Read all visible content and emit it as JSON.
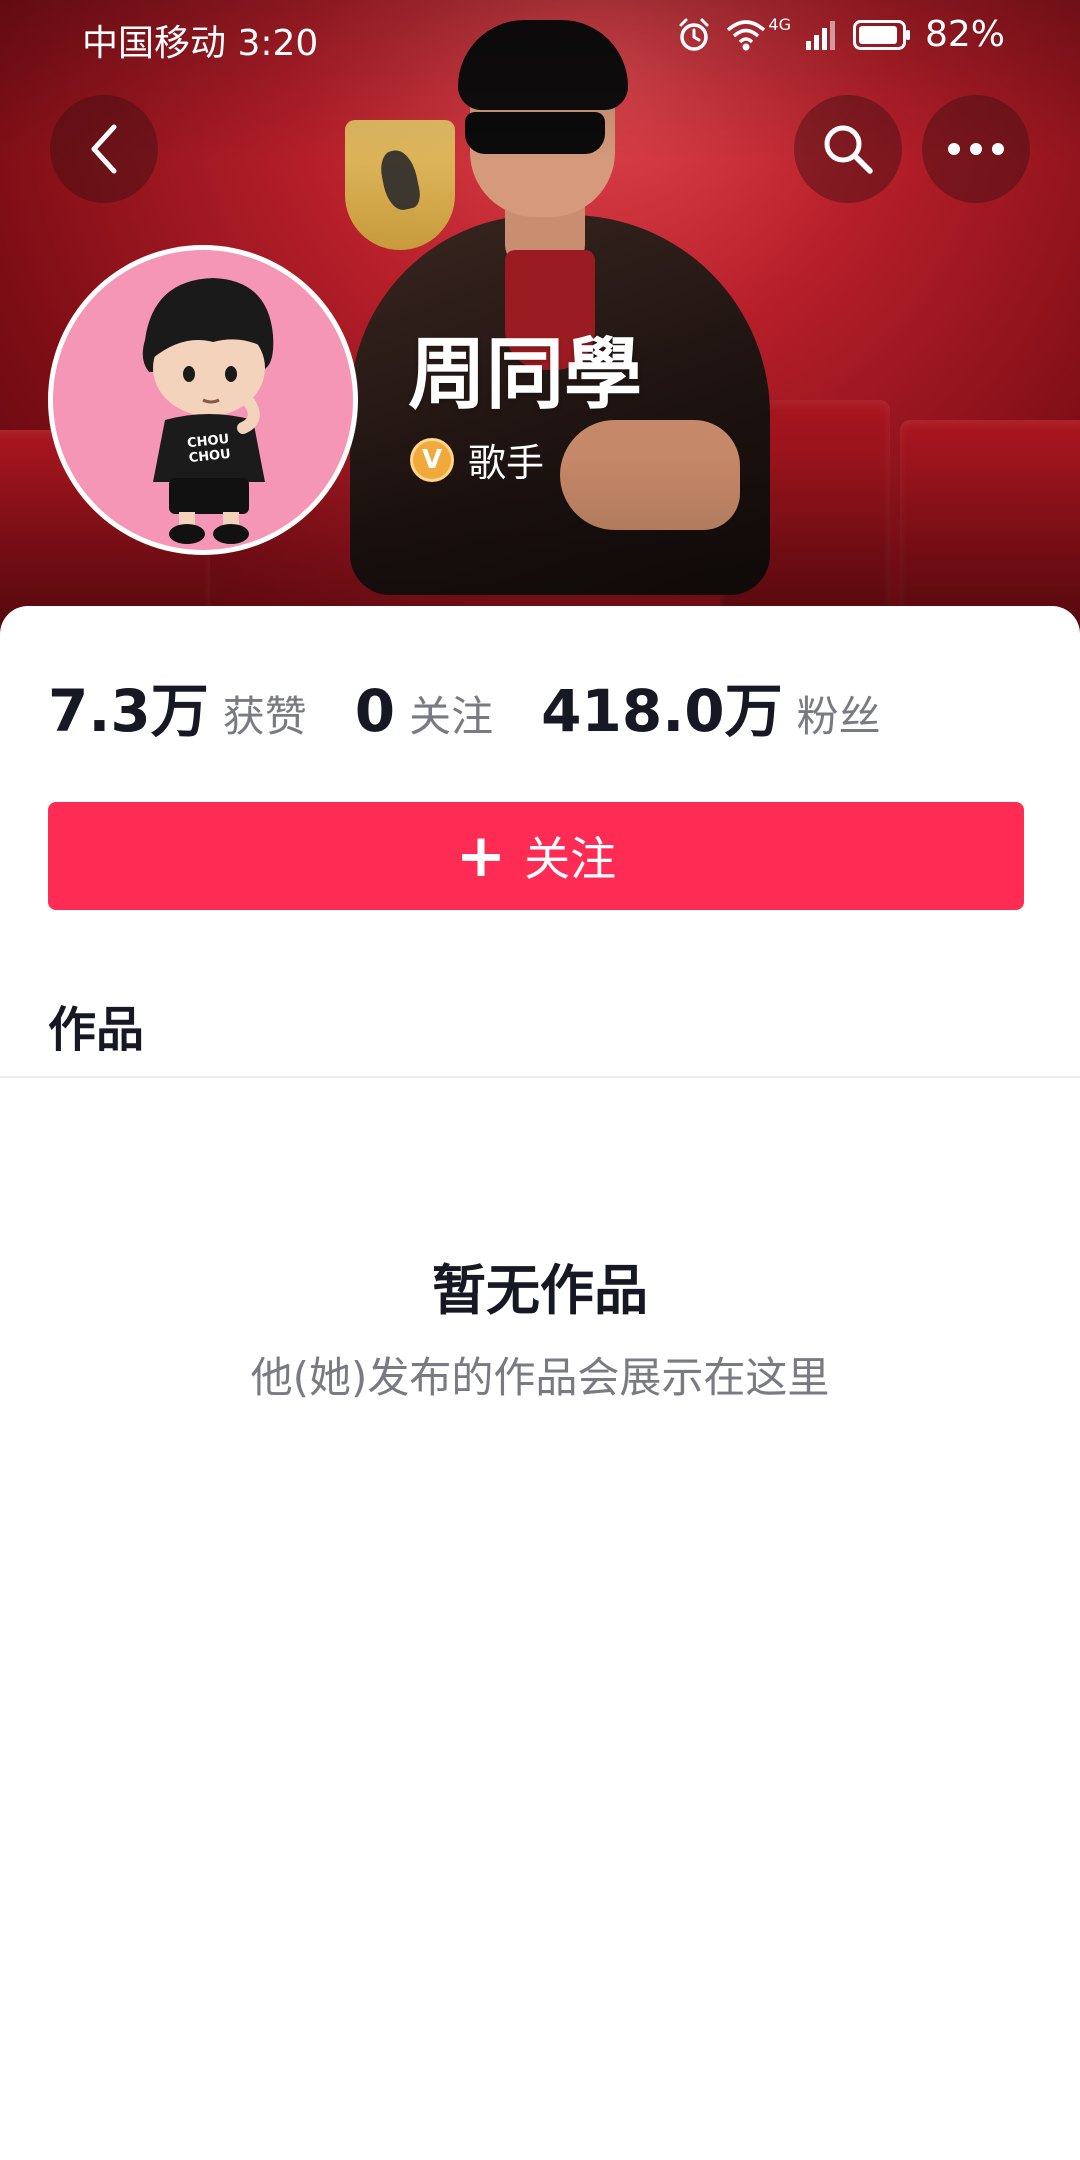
{
  "status_bar": {
    "carrier_time": "中国移动 3:20",
    "network": "4G",
    "battery": "82%"
  },
  "nav": {
    "back_icon": "back-chevron-icon",
    "search_icon": "search-icon",
    "more_icon": "more-dots-icon"
  },
  "profile": {
    "name": "周同學",
    "role": "歌手",
    "role_badge": "V",
    "avatar_shirt_text": "CHOU CHOU"
  },
  "stats": [
    {
      "value": "7.3万",
      "label": "获赞"
    },
    {
      "value": "0",
      "label": "关注"
    },
    {
      "value": "418.0万",
      "label": "粉丝"
    }
  ],
  "follow_button": {
    "icon": "+",
    "label": "关注"
  },
  "tabs": {
    "works": "作品"
  },
  "empty_state": {
    "title": "暂无作品",
    "subtitle": "他(她)发布的作品会展示在这里"
  },
  "colors": {
    "accent": "#fe2c55",
    "text_primary": "#161823",
    "text_secondary": "#7a7b82",
    "cover_red": "#b71f2a",
    "badge_gold": "#f2a93c",
    "avatar_bg": "#f596b6"
  }
}
